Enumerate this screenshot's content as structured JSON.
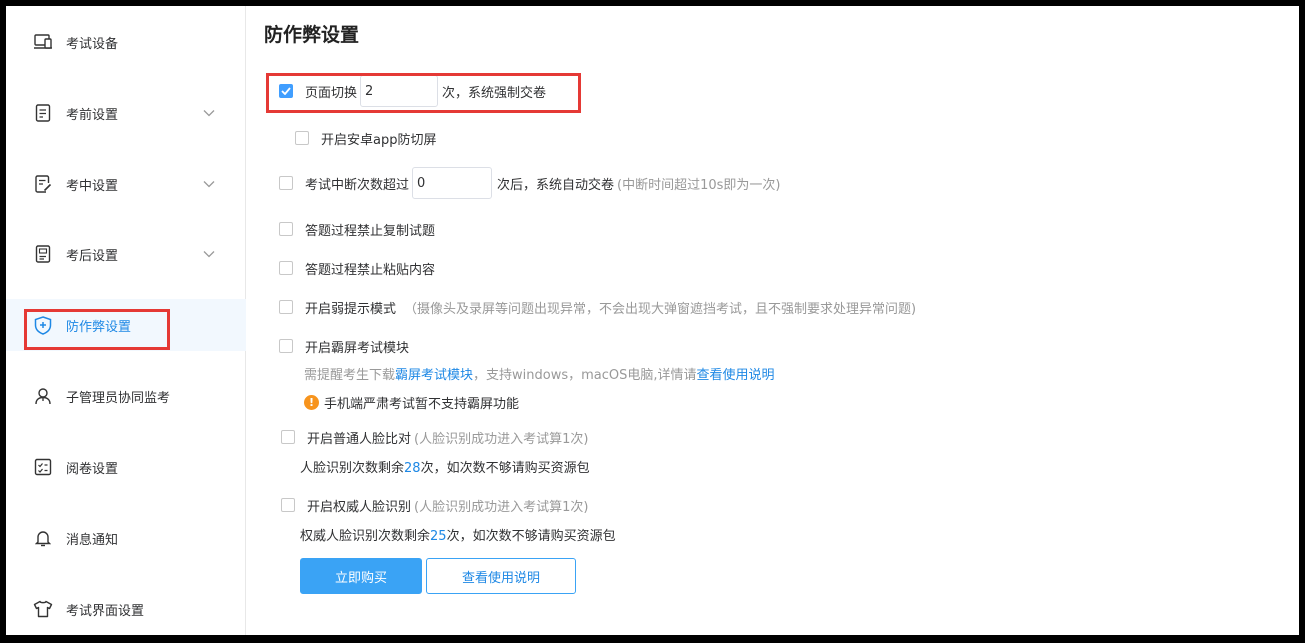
{
  "sidebar": {
    "items": [
      {
        "label": "考试设备",
        "icon": "laptop-icon",
        "has_chevron": false
      },
      {
        "label": "考前设置",
        "icon": "document-icon",
        "has_chevron": true
      },
      {
        "label": "考中设置",
        "icon": "edit-document-icon",
        "has_chevron": true
      },
      {
        "label": "考后设置",
        "icon": "report-icon",
        "has_chevron": true
      },
      {
        "label": "防作弊设置",
        "icon": "shield-icon",
        "has_chevron": false,
        "active": true
      },
      {
        "label": "子管理员协同监考",
        "icon": "user-icon",
        "has_chevron": false
      },
      {
        "label": "阅卷设置",
        "icon": "grading-icon",
        "has_chevron": false
      },
      {
        "label": "消息通知",
        "icon": "bell-icon",
        "has_chevron": false
      },
      {
        "label": "考试界面设置",
        "icon": "shirt-icon",
        "has_chevron": false
      }
    ]
  },
  "main": {
    "title": "防作弊设置",
    "page_switch": {
      "checked": true,
      "prefix": "页面切换",
      "value": "2",
      "suffix": "次，系统强制交卷"
    },
    "android_screen": {
      "checked": false,
      "label": "开启安卓app防切屏"
    },
    "interrupt": {
      "checked": false,
      "prefix": "考试中断次数超过",
      "value": "0",
      "suffix": "次后，系统自动交卷",
      "hint": "(中断时间超过10s即为一次)"
    },
    "no_copy": {
      "checked": false,
      "label": "答题过程禁止复制试题"
    },
    "no_paste": {
      "checked": false,
      "label": "答题过程禁止粘贴内容"
    },
    "weak_hint": {
      "checked": false,
      "label": "开启弱提示模式",
      "hint": "（摄像头及录屏等问题出现异常，不会出现大弹窗遮挡考试，且不强制要求处理异常问题)"
    },
    "lockscreen": {
      "checked": false,
      "label": "开启霸屏考试模块",
      "desc_prefix": "需提醒考生下载",
      "desc_link": "霸屏考试模块",
      "desc_middle": "，支持windows，macOS电脑,详情请",
      "desc_link2": "查看使用说明",
      "warning": "手机端严肃考试暂不支持霸屏功能",
      "warning_icon": "!"
    },
    "face_normal": {
      "checked": false,
      "label": "开启普通人脸比对",
      "hint": "(人脸识别成功进入考试算1次)",
      "remain_prefix": "人脸识别次数剩余",
      "remain_count": "28",
      "remain_suffix": "次，如次数不够请购买资源包"
    },
    "face_auth": {
      "checked": false,
      "label": "开启权威人脸识别",
      "hint": "(人脸识别成功进入考试算1次)",
      "remain_prefix": "权威人脸识别次数剩余",
      "remain_count": "25",
      "remain_suffix": "次，如次数不够请购买资源包"
    },
    "buttons": {
      "buy": "立即购买",
      "guide": "查看使用说明"
    }
  },
  "colors": {
    "accent": "#1e88e5",
    "highlight": "#e53935",
    "warning": "#f7941d"
  }
}
